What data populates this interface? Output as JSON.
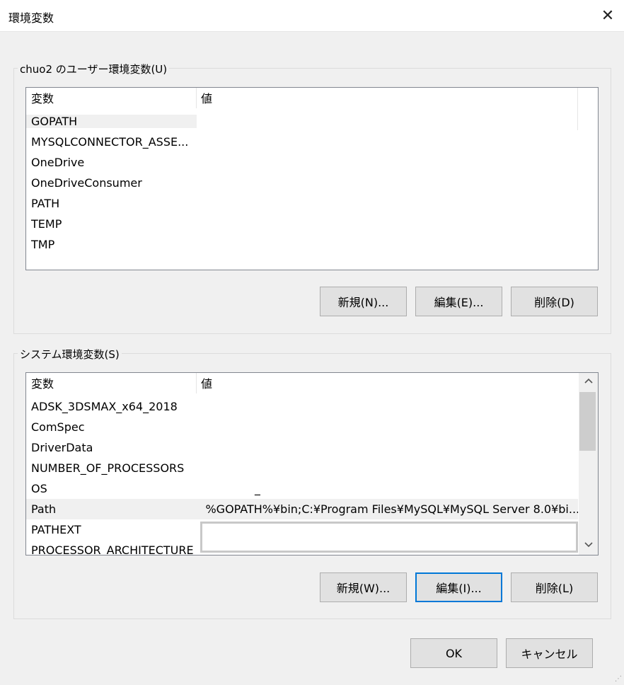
{
  "window": {
    "title": "環境変数",
    "close_glyph": "✕"
  },
  "user_vars": {
    "group_label": "chuo2 のユーザー環境変数(U)",
    "header": {
      "name": "変数",
      "value": "値"
    },
    "rows": [
      {
        "name": "GOPATH",
        "value": ""
      },
      {
        "name": "MYSQLCONNECTOR_ASSE...",
        "value": ""
      },
      {
        "name": "OneDrive",
        "value": ""
      },
      {
        "name": "OneDriveConsumer",
        "value": ""
      },
      {
        "name": "PATH",
        "value": ""
      },
      {
        "name": "TEMP",
        "value": ""
      },
      {
        "name": "TMP",
        "value": ""
      }
    ],
    "buttons": {
      "new": "新規(N)...",
      "edit": "編集(E)...",
      "delete": "削除(D)"
    }
  },
  "system_vars": {
    "group_label": "システム環境変数(S)",
    "header": {
      "name": "変数",
      "value": "値"
    },
    "rows": [
      {
        "name": "ADSK_3DSMAX_x64_2018",
        "value": ""
      },
      {
        "name": "ComSpec",
        "value": ""
      },
      {
        "name": "DriverData",
        "value": ""
      },
      {
        "name": "NUMBER_OF_PROCESSORS",
        "value": ""
      },
      {
        "name": "OS",
        "value": "_"
      },
      {
        "name": "Path",
        "value": "%GOPATH%¥bin;C:¥Program Files¥MySQL¥MySQL Server 8.0¥bi..."
      },
      {
        "name": "PATHEXT",
        "value": ""
      },
      {
        "name": "PROCESSOR_ARCHITECTURE",
        "value": ""
      }
    ],
    "buttons": {
      "new": "新規(W)...",
      "edit": "編集(I)...",
      "delete": "削除(L)"
    }
  },
  "footer": {
    "ok": "OK",
    "cancel": "キャンセル"
  },
  "icons": {
    "scroll_up": "chevron-up-icon",
    "scroll_down": "chevron-down-icon"
  }
}
